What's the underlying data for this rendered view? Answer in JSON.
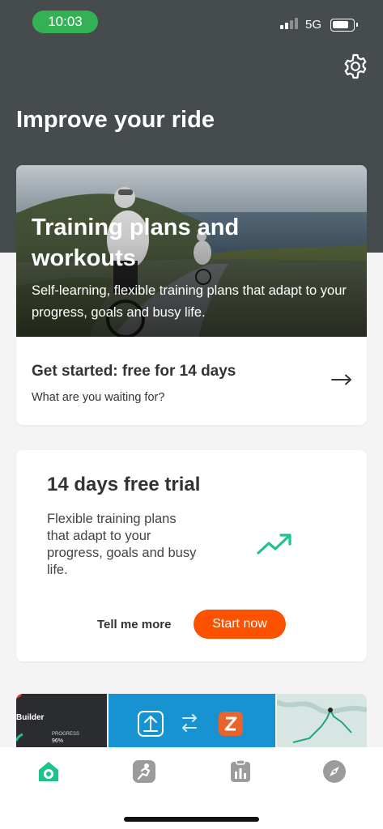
{
  "status_bar": {
    "time": "10:03",
    "network": "5G",
    "time_pill_color": "#35b155"
  },
  "header": {
    "title": "Improve your ride",
    "settings_icon": "gear-icon",
    "background_color": "#464b4d"
  },
  "training_card": {
    "hero_title": "Training plans and workouts",
    "hero_subtitle": "Self-learning, flexible training plans that adapt to your progress, goals and busy life.",
    "cta_title": "Get started: free for 14 days",
    "cta_subtitle": "What are you waiting for?",
    "cta_icon": "arrow-right-icon"
  },
  "trial_card": {
    "title": "14 days free trial",
    "body": "Flexible training plans that adapt to your progress, goals and busy life.",
    "icon": "trending-up-icon",
    "icon_color": "#1ec38c",
    "secondary_button": "Tell me more",
    "primary_button": "Start now",
    "primary_color": "#fc5200"
  },
  "partners_strip": {
    "first_panel_label": "Builder",
    "first_panel_small_text": "PROGRESS",
    "first_panel_value": "96%"
  },
  "tab_bar": {
    "tabs": [
      {
        "icon": "home-icon",
        "active": true
      },
      {
        "icon": "training-icon",
        "active": false
      },
      {
        "icon": "stats-icon",
        "active": false
      },
      {
        "icon": "explore-compass-icon",
        "active": false
      }
    ],
    "active_color": "#1ec38c",
    "inactive_color": "#9b9b9b"
  }
}
